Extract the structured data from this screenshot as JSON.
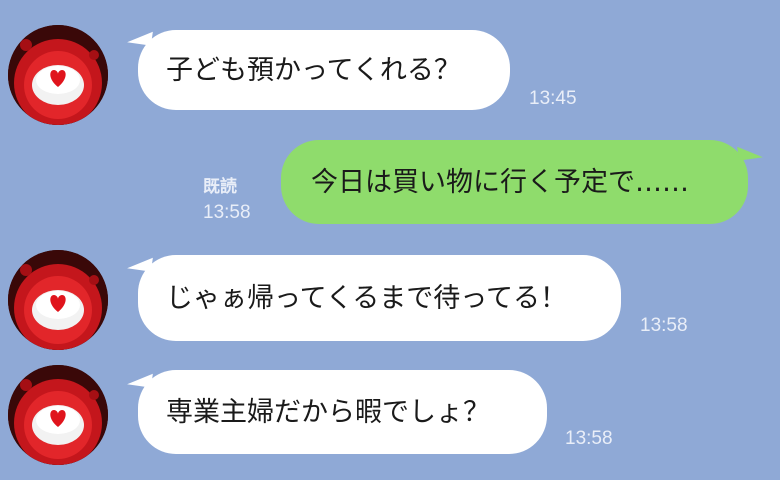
{
  "messages": [
    {
      "side": "incoming",
      "text": "子ども預かってくれる？",
      "time": "13:45"
    },
    {
      "side": "outgoing",
      "text": "今日は買い物に行く予定で……",
      "time": "13:58",
      "read_label": "既読"
    },
    {
      "side": "incoming",
      "text": "じゃぁ帰ってくるまで待ってる！",
      "time": "13:58"
    },
    {
      "side": "incoming",
      "text": "専業主婦だから暇でしょ？",
      "time": "13:58"
    }
  ],
  "colors": {
    "background": "#8fa9d6",
    "incoming_bubble": "#ffffff",
    "outgoing_bubble": "#8fdc6c",
    "meta_text": "#e9eef8"
  }
}
